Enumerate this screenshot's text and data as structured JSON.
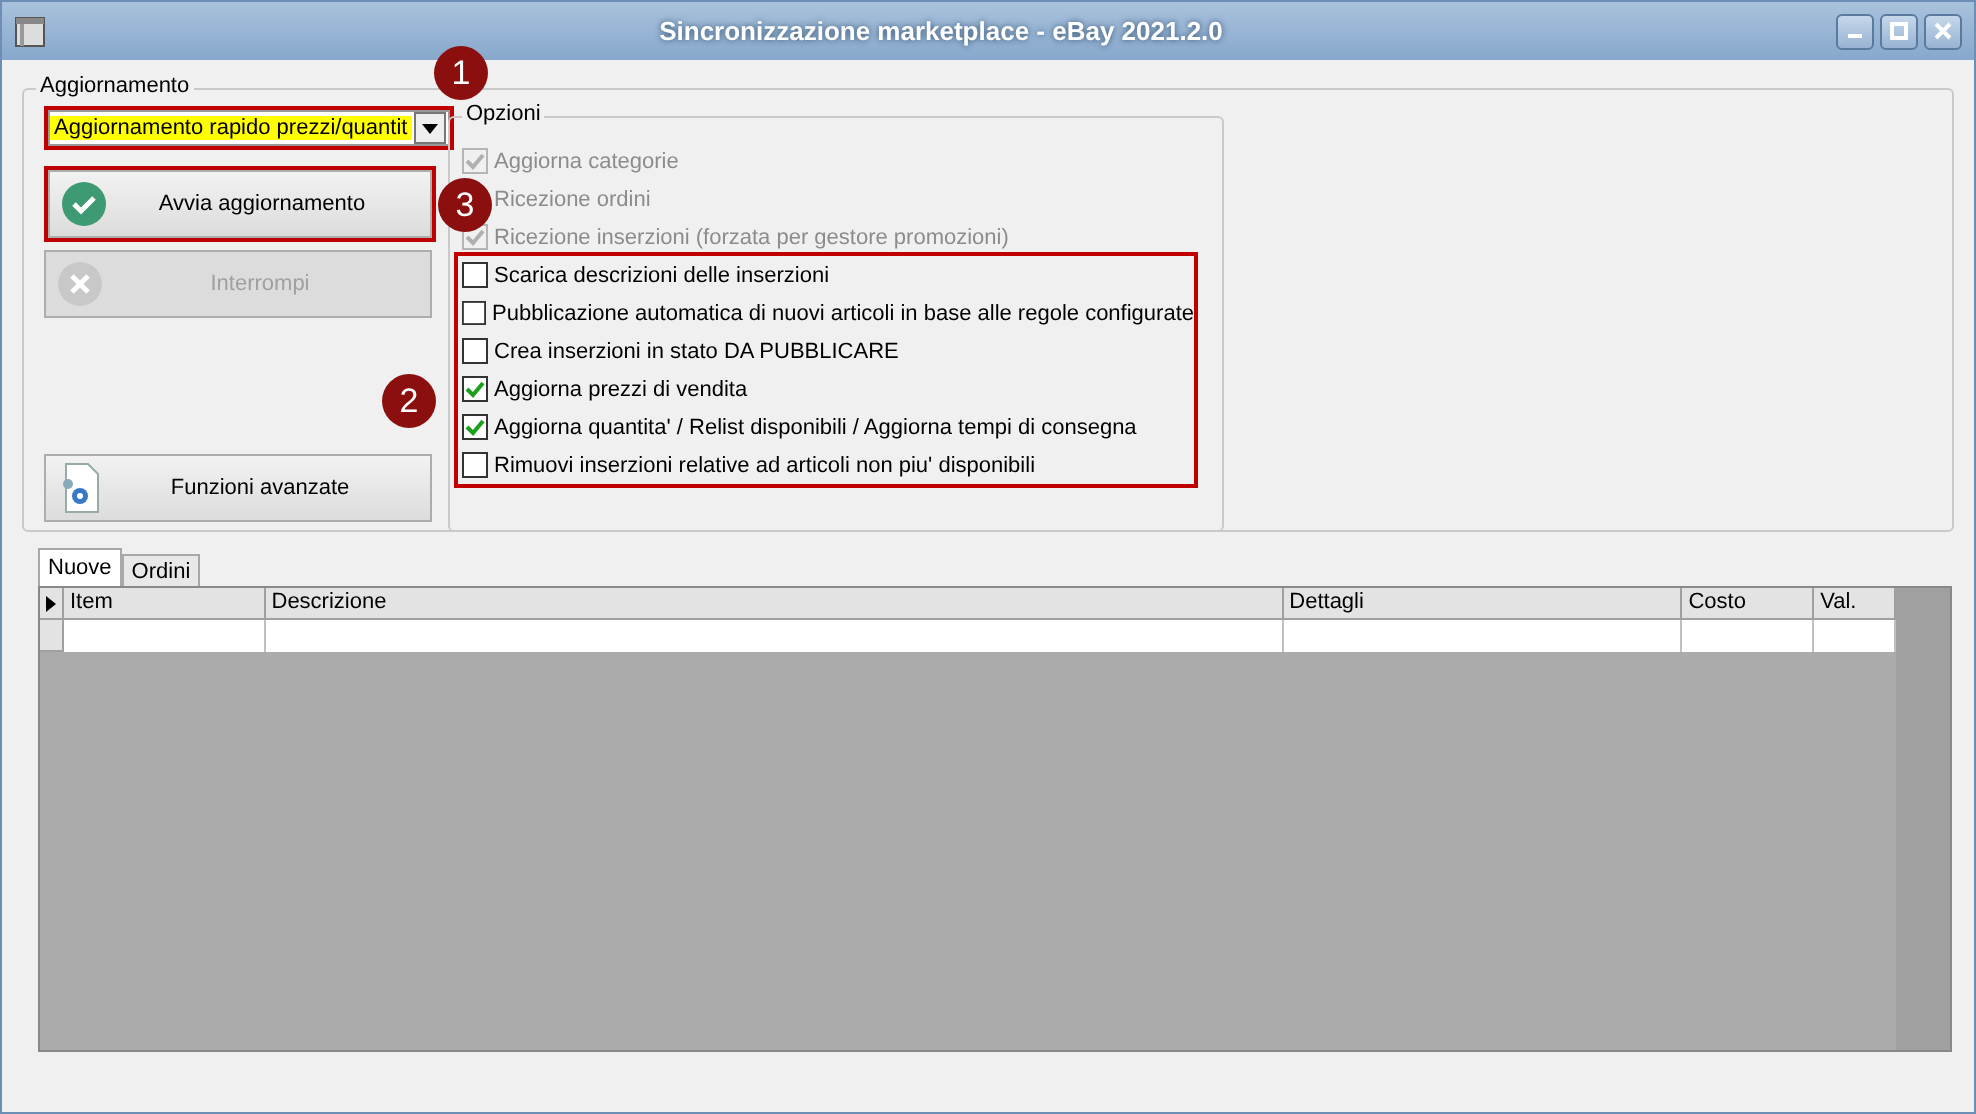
{
  "window": {
    "title": "Sincronizzazione marketplace - eBay 2021.2.0"
  },
  "update_group": {
    "label": "Aggiornamento",
    "mode": {
      "value": "Aggiornamento rapido prezzi/quantit",
      "highlighted": true
    },
    "buttons": [
      {
        "label": "Avvia aggiornamento",
        "kind": "start",
        "disabled": false,
        "highlighted": true
      },
      {
        "label": "Interrompi",
        "kind": "stop",
        "disabled": true,
        "highlighted": false
      },
      {
        "label": "Funzioni avanzate",
        "kind": "advanced",
        "disabled": false,
        "highlighted": false
      }
    ]
  },
  "options": {
    "label": "Opzioni",
    "items": [
      {
        "label": "Aggiorna categorie",
        "checked": true,
        "disabled": true,
        "highlighted": false
      },
      {
        "label": "Ricezione ordini",
        "disabled": true,
        "highlighted": false
      },
      {
        "label": "Ricezione inserzioni (forzata per gestore promozioni)",
        "checked": true,
        "disabled": true,
        "highlighted": false
      },
      {
        "label": "Scarica descrizioni delle inserzioni",
        "checked": false,
        "disabled": false,
        "highlighted": true
      },
      {
        "label": "Pubblicazione automatica di nuovi articoli in base alle regole configurate",
        "checked": false,
        "disabled": false,
        "highlighted": true
      },
      {
        "label": "Crea inserzioni in stato DA PUBBLICARE",
        "checked": false,
        "disabled": false,
        "highlighted": true
      },
      {
        "label": "Aggiorna prezzi di vendita",
        "checked": true,
        "disabled": false,
        "highlighted": true
      },
      {
        "label": "Aggiorna quantita' / Relist disponibili / Aggiorna tempi di consegna",
        "checked": true,
        "disabled": false,
        "highlighted": true
      },
      {
        "label": "Rimuovi inserzioni relative ad articoli non piu' disponibili",
        "checked": false,
        "disabled": false,
        "highlighted": true
      }
    ]
  },
  "callouts": [
    {
      "number": "1"
    },
    {
      "number": "2"
    },
    {
      "number": "3"
    }
  ],
  "tabs": [
    {
      "label": "Nuove",
      "selected": true
    },
    {
      "label": "Ordini",
      "selected": false
    }
  ],
  "table": {
    "columns": [
      "Item",
      "Descrizione",
      "Dettagli",
      "Costo",
      "Val."
    ]
  }
}
